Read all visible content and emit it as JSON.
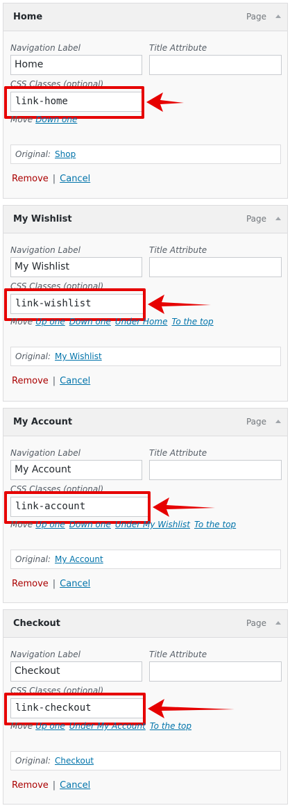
{
  "labels": {
    "nav_label": "Navigation Label",
    "title_attr": "Title Attribute",
    "css_classes": "CSS Classes (optional)",
    "move": "Move",
    "original": "Original:",
    "remove": "Remove",
    "separator": "|",
    "cancel": "Cancel"
  },
  "colors": {
    "highlight": "#e60000",
    "link": "#0073aa",
    "remove": "#aa0000"
  },
  "items": [
    {
      "title": "Home",
      "type": "Page",
      "nav_label_value": "Home",
      "title_attr_value": "",
      "css_class": "link-home",
      "move_links": [
        "Down one"
      ],
      "original": "Shop"
    },
    {
      "title": "My Wishlist",
      "type": "Page",
      "nav_label_value": "My Wishlist",
      "title_attr_value": "",
      "css_class": "link-wishlist",
      "move_links": [
        "Up one",
        "Down one",
        "Under Home",
        "To the top"
      ],
      "original": "My Wishlist"
    },
    {
      "title": "My Account",
      "type": "Page",
      "nav_label_value": "My Account",
      "title_attr_value": "",
      "css_class": "link-account",
      "move_links": [
        "Up one",
        "Down one",
        "Under My Wishlist",
        "To the top"
      ],
      "original": "My Account"
    },
    {
      "title": "Checkout",
      "type": "Page",
      "nav_label_value": "Checkout",
      "title_attr_value": "",
      "css_class": "link-checkout",
      "move_links": [
        "Up one",
        "Under My Account",
        "To the top"
      ],
      "original": "Checkout"
    }
  ]
}
